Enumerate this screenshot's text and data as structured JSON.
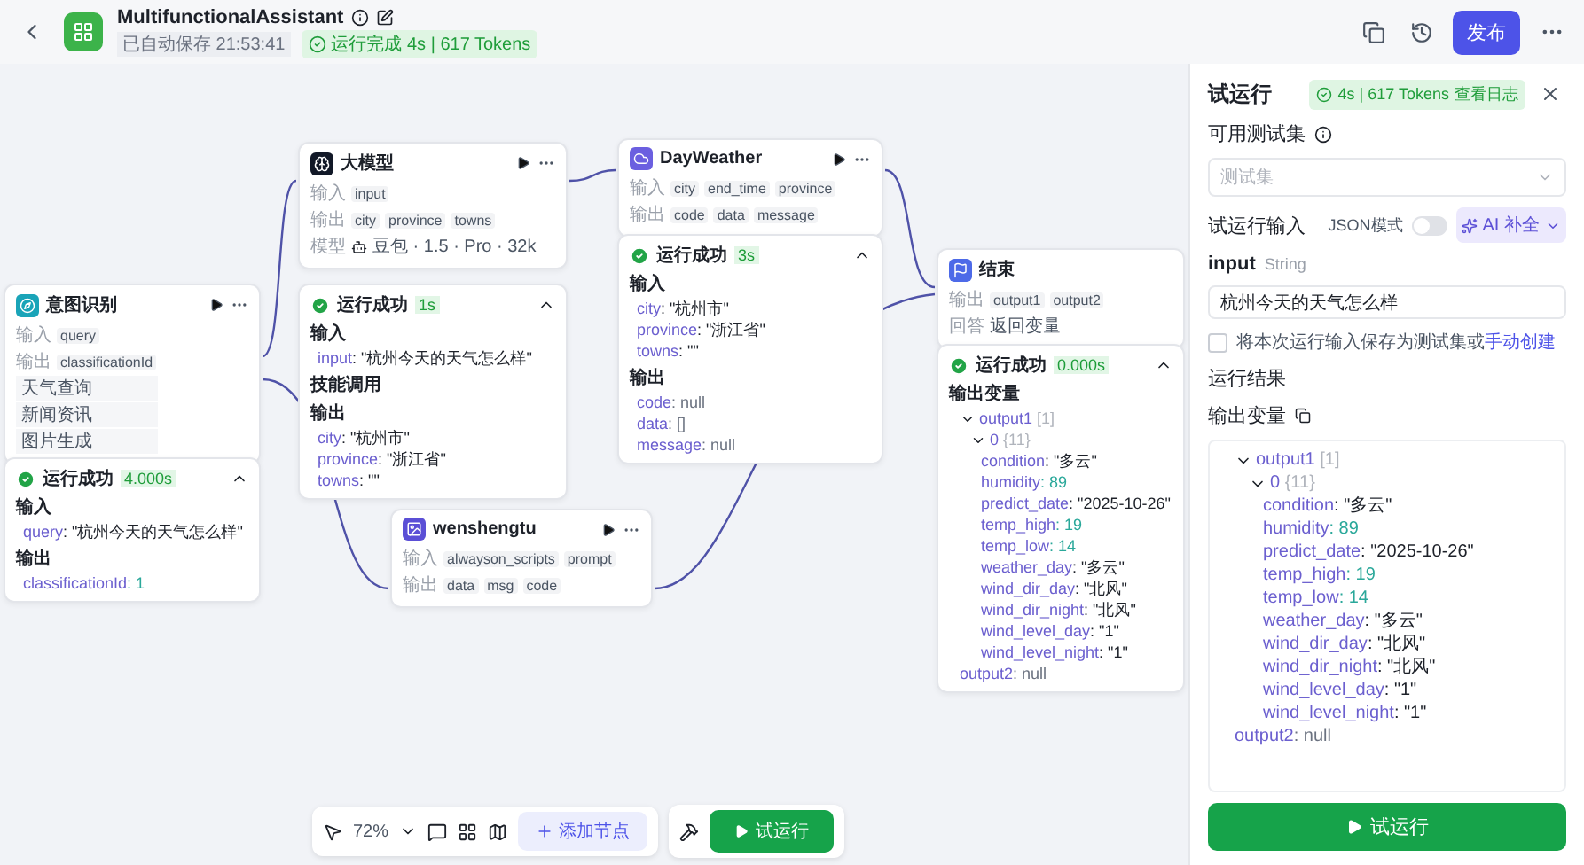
{
  "header": {
    "title": "MultifunctionalAssistant",
    "saved": "已自动保存 21:53:41",
    "run_status": "运行完成 4s | 617 Tokens",
    "publish": "发布"
  },
  "nodes": [
    {
      "kind": "intent",
      "title": "意图识别",
      "rows": [
        {
          "label": "输入",
          "params": [
            "query"
          ]
        },
        {
          "label": "输出",
          "params": [
            "classificationId"
          ]
        }
      ],
      "options": [
        "天气查询",
        "新闻资讯",
        "图片生成"
      ],
      "result": {
        "status": "运行成功",
        "time": "4.000s",
        "expanded": true,
        "sections": [
          {
            "heading": "输入",
            "lines": [
              {
                "key": "query",
                "value": ": \"杭州今天的天气怎么样\"",
                "kind": "string"
              }
            ]
          },
          {
            "heading": "输出",
            "lines": [
              {
                "key": "classificationId",
                "value": ": 1",
                "kind": "number"
              }
            ]
          }
        ]
      }
    },
    {
      "kind": "llm",
      "title": "大模型",
      "rows": [
        {
          "label": "输入",
          "params": [
            "input"
          ]
        },
        {
          "label": "输出",
          "params": [
            "city",
            "province",
            "towns"
          ]
        },
        {
          "label": "模型",
          "model": "豆包 · 1.5 · Pro · 32k"
        }
      ],
      "result": {
        "status": "运行成功",
        "time": "1s",
        "expanded": true,
        "sections": [
          {
            "heading": "输入",
            "lines": [
              {
                "key": "input",
                "value": ": \"杭州今天的天气怎么样\"",
                "kind": "string"
              }
            ]
          },
          {
            "heading": "技能调用"
          },
          {
            "heading": "输出",
            "lines": [
              {
                "key": "city",
                "value": ": \"杭州市\"",
                "kind": "string"
              },
              {
                "key": "province",
                "value": ": \"浙江省\"",
                "kind": "string"
              },
              {
                "key": "towns",
                "value": ": \"\"",
                "kind": "string"
              }
            ]
          }
        ]
      }
    },
    {
      "kind": "plugin",
      "title": "DayWeather",
      "rows": [
        {
          "label": "输入",
          "params": [
            "city",
            "end_time",
            "province"
          ]
        },
        {
          "label": "输出",
          "params": [
            "code",
            "data",
            "message"
          ]
        }
      ],
      "result": {
        "status": "运行成功",
        "time": "3s",
        "expanded": true,
        "sections": [
          {
            "heading": "输入",
            "lines": [
              {
                "key": "city",
                "value": ": \"杭州市\"",
                "kind": "string"
              },
              {
                "key": "province",
                "value": ": \"浙江省\"",
                "kind": "string"
              },
              {
                "key": "towns",
                "value": ": \"\"",
                "kind": "string"
              }
            ]
          },
          {
            "heading": "输出",
            "lines": [
              {
                "key": "code",
                "value": ": null",
                "kind": "null"
              },
              {
                "key": "data",
                "value": ": []",
                "kind": "null"
              },
              {
                "key": "message",
                "value": ": null",
                "kind": "null"
              }
            ]
          }
        ]
      }
    },
    {
      "kind": "end",
      "title": "结束",
      "rows": [
        {
          "label": "输出",
          "params": [
            "output1",
            "output2"
          ]
        },
        {
          "label": "回答",
          "text": "返回变量"
        }
      ],
      "result": {
        "status": "运行成功",
        "time": "0.000s",
        "expanded": true,
        "sections": [
          {
            "heading": "输出变量",
            "tree": [
              {
                "key": "output1",
                "type": "[1]",
                "expanded": true,
                "children": [
                  {
                    "key": "0",
                    "type": "{11}",
                    "expanded": true,
                    "children": [
                      {
                        "key": "condition",
                        "value": ": \"多云\"",
                        "kind": "string"
                      },
                      {
                        "key": "humidity",
                        "value": ": 89",
                        "kind": "number"
                      },
                      {
                        "key": "predict_date",
                        "value": ": \"2025-10-26\"",
                        "kind": "string"
                      },
                      {
                        "key": "temp_high",
                        "value": ": 19",
                        "kind": "number"
                      },
                      {
                        "key": "temp_low",
                        "value": ": 14",
                        "kind": "number"
                      },
                      {
                        "key": "weather_day",
                        "value": ": \"多云\"",
                        "kind": "string"
                      },
                      {
                        "key": "wind_dir_day",
                        "value": ": \"北风\"",
                        "kind": "string"
                      },
                      {
                        "key": "wind_dir_night",
                        "value": ": \"北风\"",
                        "kind": "string"
                      },
                      {
                        "key": "wind_level_day",
                        "value": ": \"1\"",
                        "kind": "string"
                      },
                      {
                        "key": "wind_level_night",
                        "value": ": \"1\"",
                        "kind": "string"
                      }
                    ]
                  }
                ]
              },
              {
                "key": "output2",
                "value": ": null",
                "kind": "null"
              }
            ]
          }
        ]
      }
    },
    {
      "kind": "image",
      "title": "wenshengtu",
      "rows": [
        {
          "label": "输入",
          "params": [
            "alwayson_scripts",
            "prompt"
          ]
        },
        {
          "label": "输出",
          "params": [
            "data",
            "msg",
            "code"
          ]
        }
      ]
    }
  ],
  "toolbar": {
    "zoom": "72%",
    "add_node": "添加节点",
    "run": "试运行"
  },
  "panel": {
    "title": "试运行",
    "badge": "4s | 617 Tokens",
    "log_link": "查看日志",
    "testset_label": "可用测试集",
    "testset_placeholder": "测试集",
    "input_title": "试运行输入",
    "json_mode": {
      "label": "JSON模式",
      "on": false
    },
    "ai_button": "AI 补全",
    "input_name": "input",
    "input_type": "String",
    "input_value": "杭州今天的天气怎么样",
    "save": {
      "text": "将本次运行输入保存为测试集或",
      "link": "手动创建",
      "checked": false
    },
    "result_title": "运行结果",
    "output_title": "输出变量",
    "output_tree": [
      {
        "key": "output1",
        "type": "[1]",
        "expanded": true,
        "children": [
          {
            "key": "0",
            "type": "{11}",
            "expanded": true,
            "children": [
              {
                "key": "condition",
                "value": ": \"多云\"",
                "kind": "string"
              },
              {
                "key": "humidity",
                "value": ": 89",
                "kind": "number"
              },
              {
                "key": "predict_date",
                "value": ": \"2025-10-26\"",
                "kind": "string"
              },
              {
                "key": "temp_high",
                "value": ": 19",
                "kind": "number"
              },
              {
                "key": "temp_low",
                "value": ": 14",
                "kind": "number"
              },
              {
                "key": "weather_day",
                "value": ": \"多云\"",
                "kind": "string"
              },
              {
                "key": "wind_dir_day",
                "value": ": \"北风\"",
                "kind": "string"
              },
              {
                "key": "wind_dir_night",
                "value": ": \"北风\"",
                "kind": "string"
              },
              {
                "key": "wind_level_day",
                "value": ": \"1\"",
                "kind": "string"
              },
              {
                "key": "wind_level_night",
                "value": ": \"1\"",
                "kind": "string"
              }
            ]
          }
        ]
      },
      {
        "key": "output2",
        "value": ": null",
        "kind": "null"
      }
    ],
    "run_button": "试运行"
  }
}
